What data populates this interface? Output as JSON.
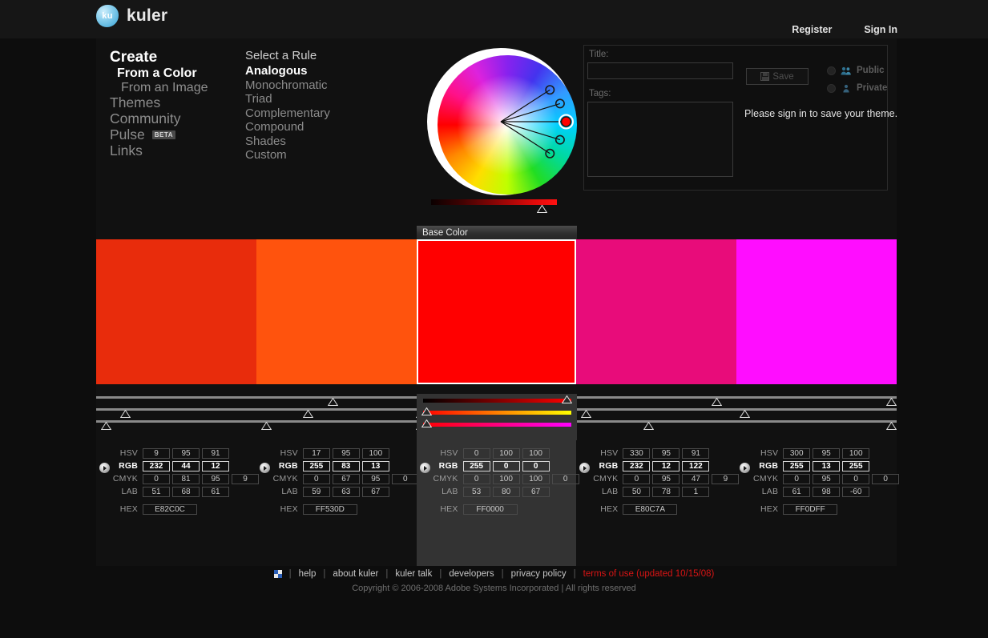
{
  "header": {
    "logo_badge": "ku",
    "logo_text": "kuler",
    "links": [
      {
        "label": "Register",
        "name": "register-link"
      },
      {
        "label": "Sign In",
        "name": "sign-in-link"
      }
    ]
  },
  "nav": {
    "items": [
      {
        "label": "Create",
        "style": "n-create",
        "name": "nav-create"
      },
      {
        "label": "From a Color",
        "style": "n-color",
        "name": "nav-from-a-color"
      },
      {
        "label": "From an Image",
        "style": "n-image",
        "name": "nav-from-an-image"
      },
      {
        "label": "Themes",
        "style": "n-plain",
        "name": "nav-themes"
      },
      {
        "label": "Community",
        "style": "n-plain",
        "name": "nav-community"
      },
      {
        "label": "Pulse",
        "style": "n-plain",
        "name": "nav-pulse",
        "badge": "BETA"
      },
      {
        "label": "Links",
        "style": "n-plain",
        "name": "nav-links"
      }
    ]
  },
  "rules": {
    "title": "Select a Rule",
    "items": [
      {
        "label": "Analogous",
        "active": true
      },
      {
        "label": "Monochromatic",
        "active": false
      },
      {
        "label": "Triad",
        "active": false
      },
      {
        "label": "Complementary",
        "active": false
      },
      {
        "label": "Compound",
        "active": false
      },
      {
        "label": "Shades",
        "active": false
      },
      {
        "label": "Custom",
        "active": false
      }
    ]
  },
  "wheel": {
    "markers": [
      {
        "index": 0,
        "color": "#E82C0C",
        "angle_deg": -33,
        "radius_pct": 87,
        "selected": false
      },
      {
        "index": 1,
        "color": "#FF530D",
        "angle_deg": -17,
        "radius_pct": 92,
        "selected": false
      },
      {
        "index": 2,
        "color": "#FF0000",
        "angle_deg": 0,
        "radius_pct": 97,
        "selected": true
      },
      {
        "index": 3,
        "color": "#E80C7A",
        "angle_deg": 17,
        "radius_pct": 92,
        "selected": false
      },
      {
        "index": 4,
        "color": "#FF0DFF",
        "angle_deg": 33,
        "radius_pct": 87,
        "selected": false
      }
    ],
    "brightness_value_pct": 96
  },
  "save_panel": {
    "title_label": "Title:",
    "title_value": "",
    "title_placeholder": "",
    "tags_label": "Tags:",
    "tags_value": "",
    "tags_placeholder": "",
    "save_label": "Save",
    "visibility": [
      {
        "label": "Public",
        "selected": false,
        "icon": "people-icon"
      },
      {
        "label": "Private",
        "selected": false,
        "icon": "person-icon"
      }
    ],
    "signin_message": "Please sign in to save your theme."
  },
  "base_tab": {
    "label": "Base Color"
  },
  "swatches": [
    {
      "name": "swatch-1",
      "hex_color": "#E82C0C",
      "is_base": false,
      "rows": [
        {
          "label": "HSV",
          "values": [
            "9",
            "95",
            "91"
          ]
        },
        {
          "label": "RGB",
          "values": [
            "232",
            "44",
            "12"
          ]
        },
        {
          "label": "CMYK",
          "values": [
            "0",
            "81",
            "95",
            "9"
          ]
        },
        {
          "label": "LAB",
          "values": [
            "51",
            "68",
            "61"
          ]
        }
      ],
      "hex_label": "HEX",
      "hex_value": "E82C0C"
    },
    {
      "name": "swatch-2",
      "hex_color": "#FF530D",
      "is_base": false,
      "rows": [
        {
          "label": "HSV",
          "values": [
            "17",
            "95",
            "100"
          ]
        },
        {
          "label": "RGB",
          "values": [
            "255",
            "83",
            "13"
          ]
        },
        {
          "label": "CMYK",
          "values": [
            "0",
            "67",
            "95",
            "0"
          ]
        },
        {
          "label": "LAB",
          "values": [
            "59",
            "63",
            "67"
          ]
        }
      ],
      "hex_label": "HEX",
      "hex_value": "FF530D"
    },
    {
      "name": "swatch-3",
      "hex_color": "#FF0000",
      "is_base": true,
      "rows": [
        {
          "label": "HSV",
          "values": [
            "0",
            "100",
            "100"
          ]
        },
        {
          "label": "RGB",
          "values": [
            "255",
            "0",
            "0"
          ]
        },
        {
          "label": "CMYK",
          "values": [
            "0",
            "100",
            "100",
            "0"
          ]
        },
        {
          "label": "LAB",
          "values": [
            "53",
            "80",
            "67"
          ]
        }
      ],
      "hex_label": "HEX",
      "hex_value": "FF0000"
    },
    {
      "name": "swatch-4",
      "hex_color": "#E80C7A",
      "is_base": false,
      "rows": [
        {
          "label": "HSV",
          "values": [
            "330",
            "95",
            "91"
          ]
        },
        {
          "label": "RGB",
          "values": [
            "232",
            "12",
            "122"
          ]
        },
        {
          "label": "CMYK",
          "values": [
            "0",
            "95",
            "47",
            "9"
          ]
        },
        {
          "label": "LAB",
          "values": [
            "50",
            "78",
            "1"
          ]
        }
      ],
      "hex_label": "HEX",
      "hex_value": "E80C7A"
    },
    {
      "name": "swatch-5",
      "hex_color": "#FF0DFF",
      "is_base": false,
      "rows": [
        {
          "label": "HSV",
          "values": [
            "300",
            "95",
            "100"
          ]
        },
        {
          "label": "RGB",
          "values": [
            "255",
            "13",
            "255"
          ]
        },
        {
          "label": "CMYK",
          "values": [
            "0",
            "95",
            "0",
            "0"
          ]
        },
        {
          "label": "LAB",
          "values": [
            "61",
            "98",
            "-60"
          ]
        }
      ],
      "hex_label": "HEX",
      "hex_value": "FF0DFF"
    }
  ],
  "sliders": {
    "rows": [
      {
        "row": 1,
        "handles_pct": [
          29.5,
          51.5,
          77.5,
          99.3
        ]
      },
      {
        "row": 2,
        "handles_pct": [
          3.6,
          26.4,
          40.5,
          61.2,
          81.0
        ]
      },
      {
        "row": 3,
        "handles_pct": [
          1.2,
          21.2,
          40.5,
          69.0,
          99.3
        ]
      }
    ],
    "base_strips": [
      {
        "gradient_from": "#000000",
        "gradient_to": "#FF0000",
        "handle_pct": 97
      },
      {
        "gradient_from": "#FF0000",
        "gradient_to": "#FFFF00",
        "handle_pct": 2
      },
      {
        "gradient_from": "#FF0000",
        "gradient_to": "#FF00FF",
        "handle_pct": 2
      }
    ]
  },
  "footer": {
    "links": [
      {
        "label": "help",
        "hot": false
      },
      {
        "label": "about kuler",
        "hot": false
      },
      {
        "label": "kuler talk",
        "hot": false
      },
      {
        "label": "developers",
        "hot": false
      },
      {
        "label": "privacy policy",
        "hot": false
      },
      {
        "label": "terms of use (updated 10/15/08)",
        "hot": true
      }
    ],
    "separator": "|",
    "copyright": "Copyright © 2006-2008 Adobe Systems Incorporated | All rights reserved"
  },
  "colors": {
    "accent_red": "#D81414",
    "logo_blue": "#57BCE4",
    "panel_bg": "#111111",
    "base_panel_bg": "#333333"
  }
}
